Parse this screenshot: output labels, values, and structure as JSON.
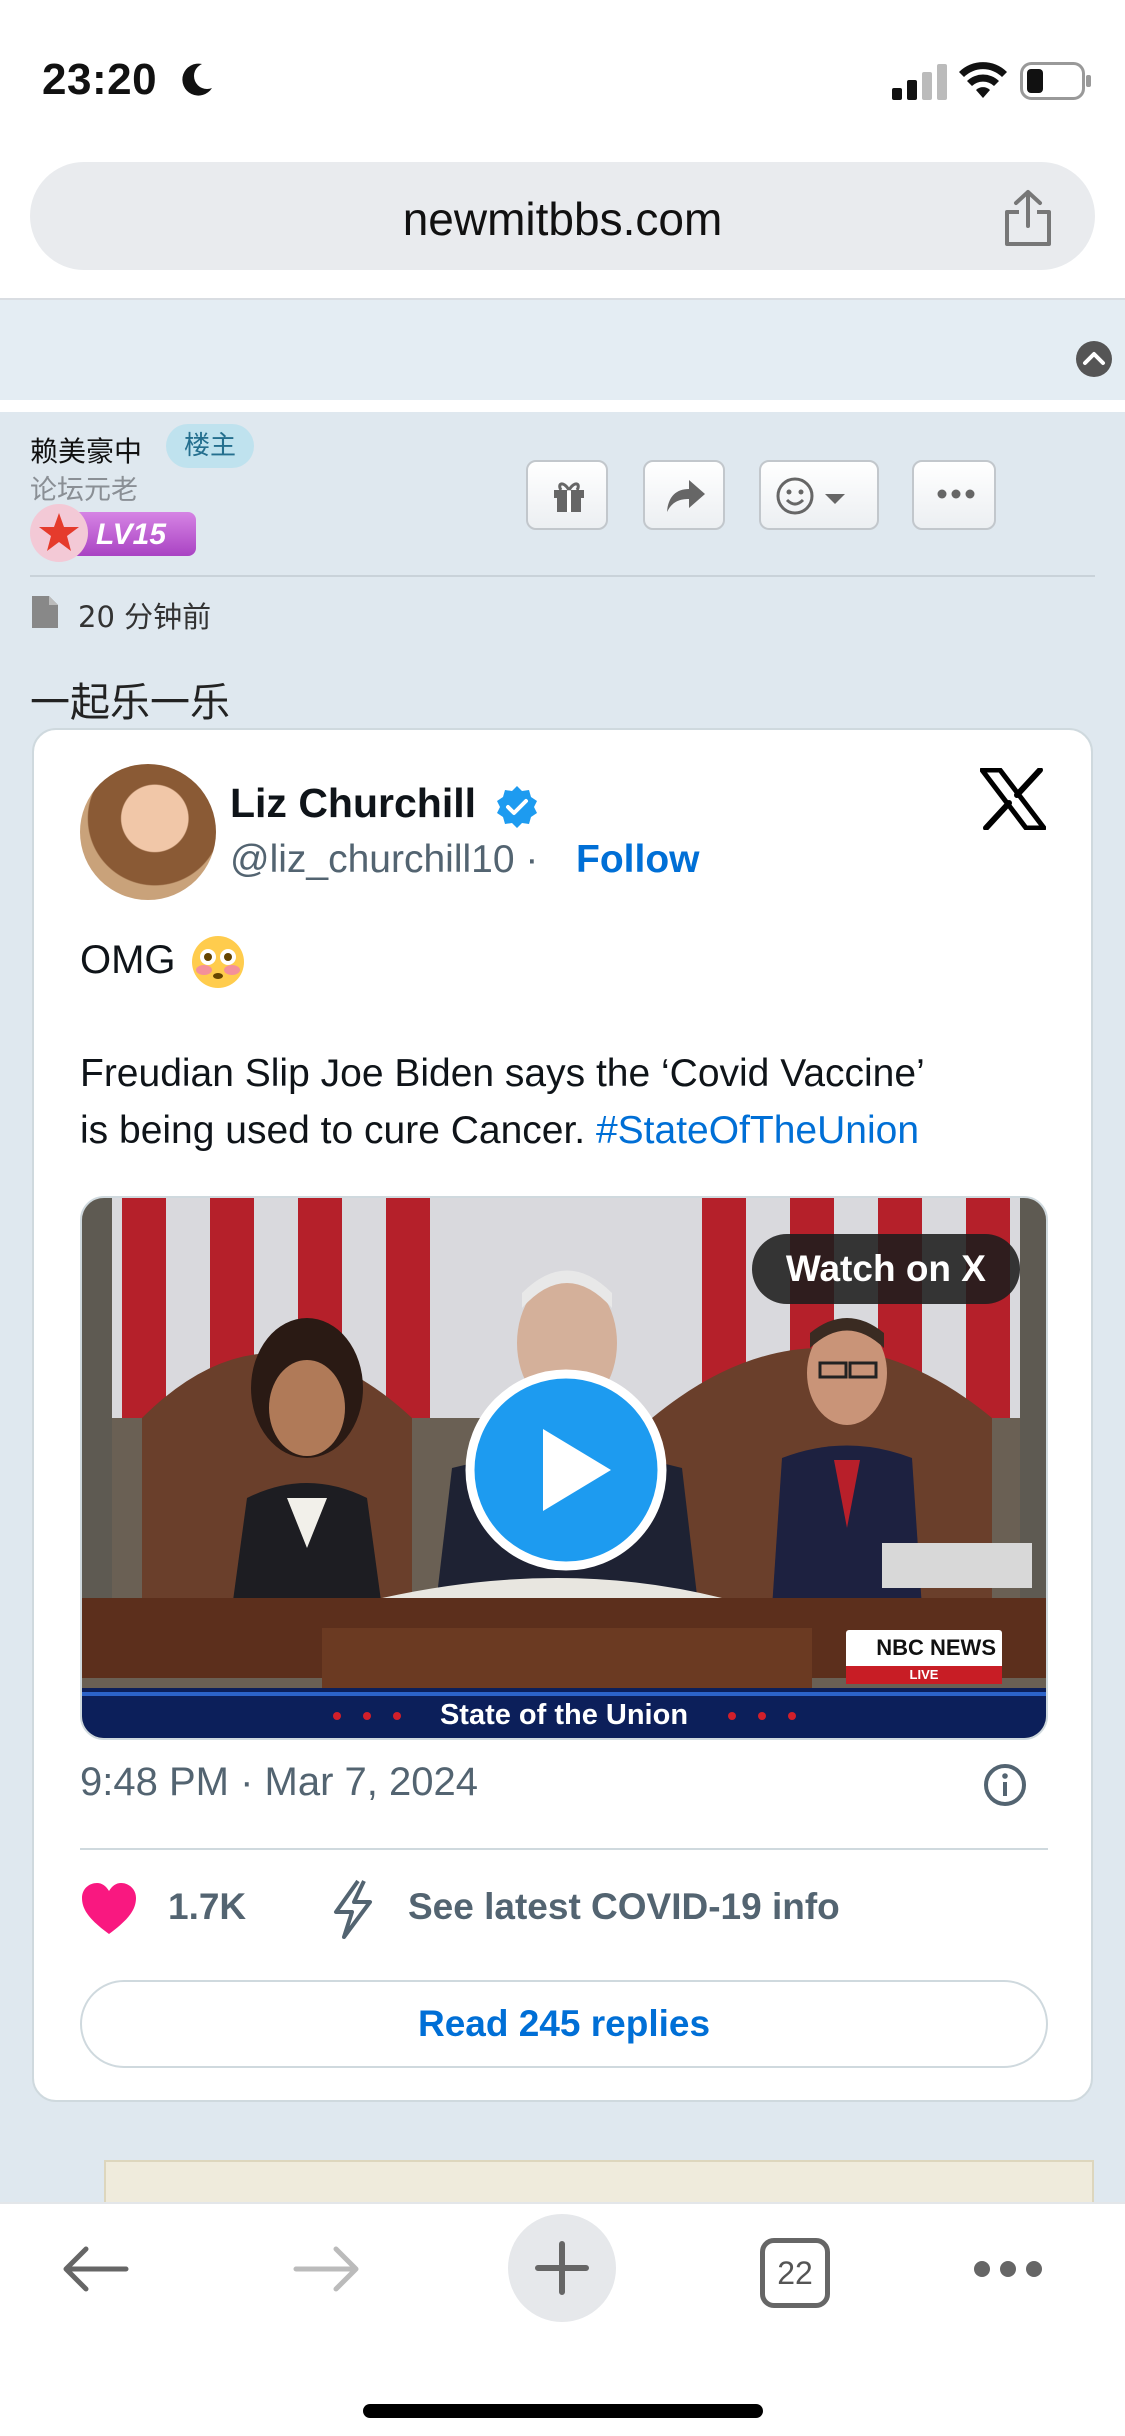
{
  "status_bar": {
    "time": "23:20",
    "moon_icon": "moon-icon",
    "signal_icon": "cellular-signal-icon",
    "wifi_icon": "wifi-icon",
    "battery_icon": "battery-icon"
  },
  "browser": {
    "url": "newmitbbs.com",
    "share_icon": "share-icon"
  },
  "post": {
    "author": "赖美豪中",
    "host_badge": "楼主",
    "author_title": "论坛元老",
    "level": "LV15",
    "actions": [
      "gift-icon",
      "forward-icon",
      "emoji-reaction-icon",
      "more-icon"
    ],
    "time_ago": "20 分钟前",
    "text": "一起乐一乐"
  },
  "tweet": {
    "name": "Liz Churchill",
    "handle": "@liz_churchill10 ·",
    "follow": "Follow",
    "line1": "OMG",
    "line2": "Freudian Slip Joe Biden says the ‘Covid Vaccine’",
    "line3_prefix": "is being used to cure Cancer. ",
    "hashtag": "#StateOfTheUnion",
    "video": {
      "watch_label": "Watch on X",
      "network": "NBC NEWS",
      "live": "LIVE",
      "banner": "State of the Union"
    },
    "datetime": "9:48 PM · Mar 7, 2024",
    "likes": "1.7K",
    "covid_link": "See latest COVID-19 info",
    "replies": "Read 245 replies"
  },
  "toolbar": {
    "tab_count": "22",
    "items": [
      "back-icon",
      "forward-icon",
      "new-tab-icon",
      "tabs-icon",
      "more-icon"
    ]
  },
  "colors": {
    "link": "#006fd6",
    "verified": "#1d9bf0",
    "heart": "#f91880",
    "page_bg": "#dfe8ef"
  }
}
